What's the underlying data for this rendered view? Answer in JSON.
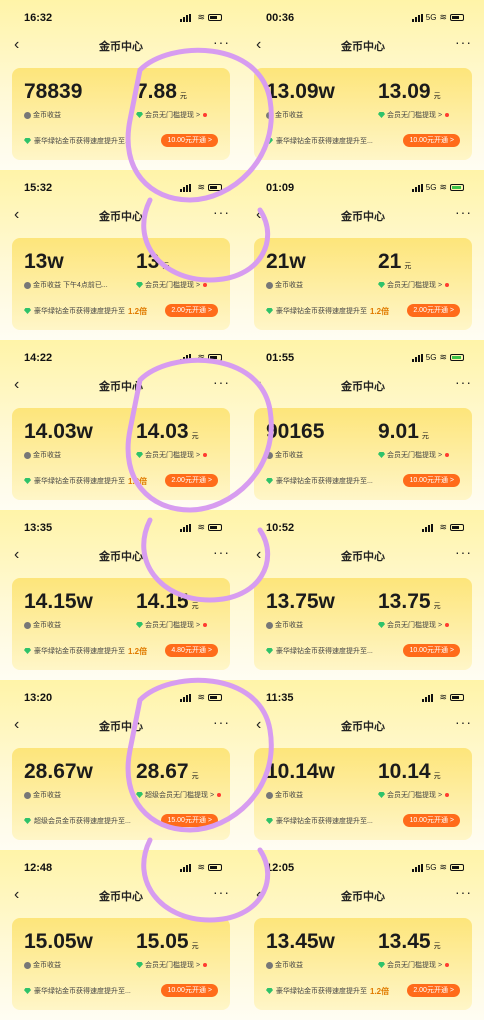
{
  "app": {
    "title": "金币中心"
  },
  "panels": [
    {
      "time": "16:32",
      "net": "",
      "batt": "normal",
      "coins": "78839",
      "cash": "7.88",
      "unit": "元",
      "coins_label": "金币收益",
      "cash_label": "会员无门槛提现 >",
      "promo": "豪华绿钻金币获得速度提升至...",
      "mult": "",
      "btn": "10.00元开通 >"
    },
    {
      "time": "00:36",
      "net": "5G",
      "batt": "normal",
      "coins": "13.09w",
      "cash": "13.09",
      "unit": "元",
      "coins_label": "金币收益",
      "cash_label": "会员无门槛提现 >",
      "promo": "豪华绿钻金币获得速度提升至...",
      "mult": "",
      "btn": "10.00元开通 >"
    },
    {
      "time": "15:32",
      "net": "",
      "batt": "normal",
      "coins": "13w",
      "cash": "13",
      "unit": "元",
      "coins_label": "金币收益 下午4点前已...",
      "cash_label": "会员无门槛提现 >",
      "promo": "豪华绿钻金币获得速度提升至",
      "mult": "1.2倍",
      "btn": "2.00元开通 >"
    },
    {
      "time": "01:09",
      "net": "5G",
      "batt": "charge",
      "coins": "21w",
      "cash": "21",
      "unit": "元",
      "coins_label": "金币收益",
      "cash_label": "会员无门槛提现 >",
      "promo": "豪华绿钻金币获得速度提升至",
      "mult": "1.2倍",
      "btn": "2.00元开通 >"
    },
    {
      "time": "14:22",
      "net": "",
      "batt": "normal",
      "coins": "14.03w",
      "cash": "14.03",
      "unit": "元",
      "coins_label": "金币收益",
      "cash_label": "会员无门槛提现 >",
      "promo": "豪华绿钻金币获得速度提升至",
      "mult": "1.2倍",
      "btn": "2.00元开通 >"
    },
    {
      "time": "01:55",
      "net": "5G",
      "batt": "charge",
      "coins": "90165",
      "cash": "9.01",
      "unit": "元",
      "coins_label": "金币收益",
      "cash_label": "会员无门槛提现 >",
      "promo": "豪华绿钻金币获得速度提升至...",
      "mult": "",
      "btn": "10.00元开通 >"
    },
    {
      "time": "13:35",
      "net": "",
      "batt": "normal",
      "coins": "14.15w",
      "cash": "14.15",
      "unit": "元",
      "coins_label": "金币收益",
      "cash_label": "会员无门槛提现 >",
      "promo": "豪华绿钻金币获得速度提升至",
      "mult": "1.2倍",
      "btn": "4.80元开通 >"
    },
    {
      "time": "10:52",
      "net": "",
      "batt": "normal",
      "coins": "13.75w",
      "cash": "13.75",
      "unit": "元",
      "coins_label": "金币收益",
      "cash_label": "会员无门槛提现 >",
      "promo": "豪华绿钻金币获得速度提升至...",
      "mult": "",
      "btn": "10.00元开通 >"
    },
    {
      "time": "13:20",
      "net": "",
      "batt": "normal",
      "coins": "28.67w",
      "cash": "28.67",
      "unit": "元",
      "coins_label": "金币收益",
      "cash_label": "超级会员无门槛提现 >",
      "promo": "超级会员金币获得速度提升至...",
      "mult": "",
      "btn": "15.00元开通 >"
    },
    {
      "time": "11:35",
      "net": "",
      "batt": "normal",
      "coins": "10.14w",
      "cash": "10.14",
      "unit": "元",
      "coins_label": "金币收益",
      "cash_label": "会员无门槛提现 >",
      "promo": "豪华绿钻金币获得速度提升至...",
      "mult": "",
      "btn": "10.00元开通 >"
    },
    {
      "time": "12:48",
      "net": "",
      "batt": "normal",
      "coins": "15.05w",
      "cash": "15.05",
      "unit": "元",
      "coins_label": "金币收益",
      "cash_label": "会员无门槛提现 >",
      "promo": "豪华绿钻金币获得速度提升至...",
      "mult": "",
      "btn": "10.00元开通 >"
    },
    {
      "time": "12:05",
      "net": "5G",
      "batt": "normal",
      "coins": "13.45w",
      "cash": "13.45",
      "unit": "元",
      "coins_label": "金币收益",
      "cash_label": "会员无门槛提现 >",
      "promo": "豪华绿钻金币获得速度提升至",
      "mult": "1.2倍",
      "btn": "2.00元开通 >"
    }
  ],
  "colors": {
    "accent": "#ff6b1a",
    "gem": "#2ec26a",
    "doodle": "#d79cf0"
  },
  "icons": {
    "back": "chevron-left-icon",
    "more": "more-dots-icon",
    "coin": "coin-icon",
    "gem": "green-diamond-icon"
  }
}
